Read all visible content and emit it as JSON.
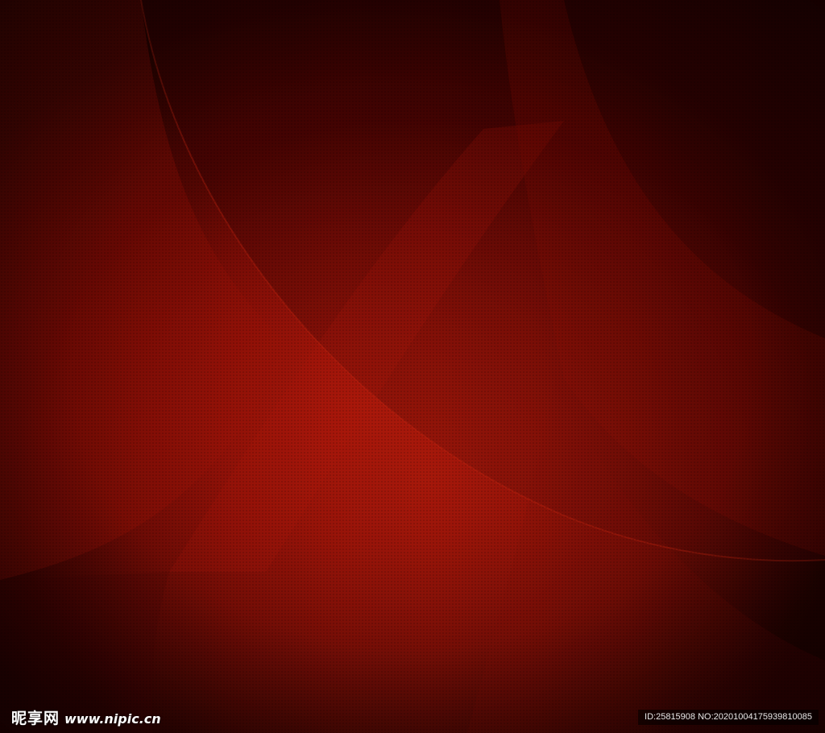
{
  "image": {
    "description": "",
    "colors": {
      "base": "#7a0b05",
      "highlight": "#b01a0c",
      "shadow": "#220100"
    }
  },
  "watermark": {
    "brand": "昵享网",
    "url": "www.nipic.cn",
    "id_text": "ID:25815908 NO:20201004175939810085"
  }
}
